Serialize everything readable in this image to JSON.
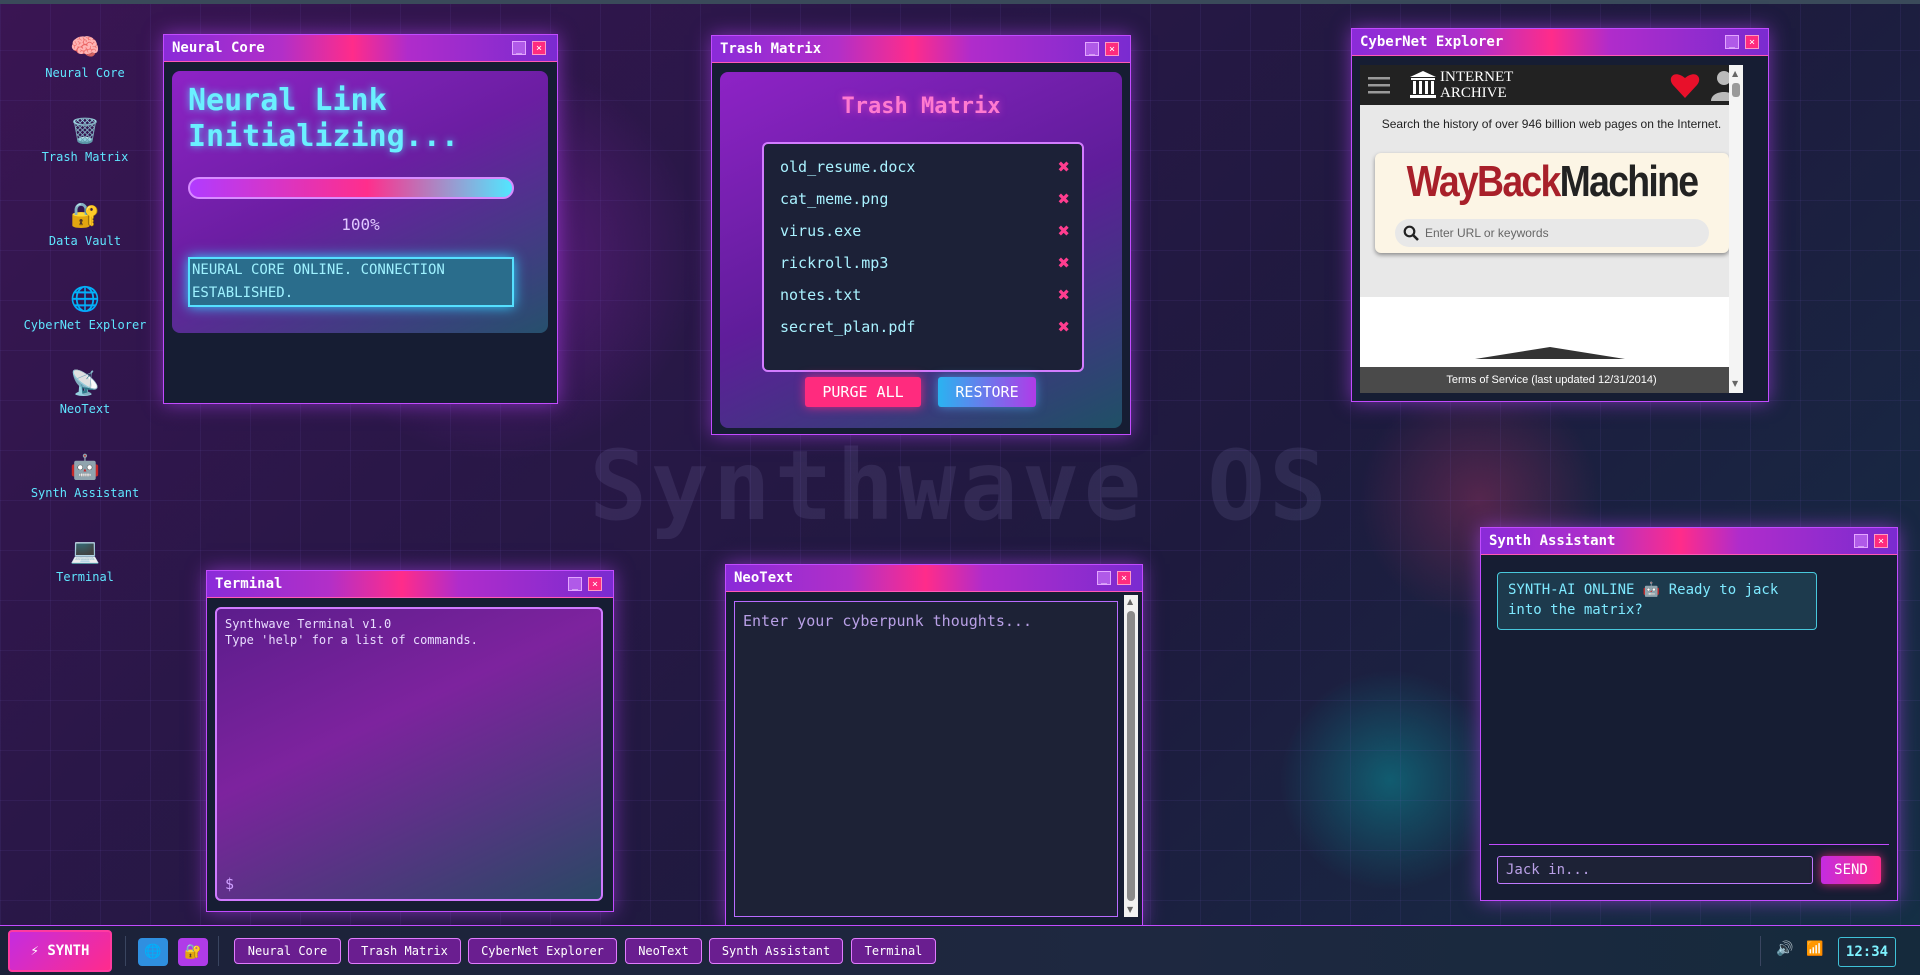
{
  "desktop": {
    "watermark": "Synthwave OS",
    "icons": [
      {
        "label": "Neural Core",
        "glyph": "🧠",
        "icon": "brain-icon"
      },
      {
        "label": "Trash Matrix",
        "glyph": "🗑️",
        "icon": "trash-icon"
      },
      {
        "label": "Data Vault",
        "glyph": "🔐",
        "icon": "lock-key-icon"
      },
      {
        "label": "CyberNet Explorer",
        "glyph": "🌐",
        "icon": "globe-icon"
      },
      {
        "label": "NeoText",
        "glyph": "📡",
        "icon": "satellite-dish-icon"
      },
      {
        "label": "Synth Assistant",
        "glyph": "🤖",
        "icon": "robot-icon"
      },
      {
        "label": "Terminal",
        "glyph": "💻",
        "icon": "laptop-icon"
      }
    ]
  },
  "window_controls": {
    "minimize": "_",
    "close": "×"
  },
  "neural_core": {
    "title": "Neural Core",
    "heading_line1": "Neural Link",
    "heading_line2": "Initializing...",
    "progress_value": 1.0,
    "progress_text": "100%",
    "status_message": "NEURAL CORE ONLINE. CONNECTION ESTABLISHED."
  },
  "trash_matrix": {
    "title": "Trash Matrix",
    "heading": "Trash Matrix",
    "files": [
      "old_resume.docx",
      "cat_meme.png",
      "virus.exe",
      "rickroll.mp3",
      "notes.txt",
      "secret_plan.pdf"
    ],
    "delete_glyph": "✖",
    "purge_label": "PURGE ALL",
    "restore_label": "RESTORE"
  },
  "cybernet_explorer": {
    "title": "CyberNet Explorer",
    "brand_line1": "INTERNET",
    "brand_line2": "ARCHIVE",
    "tagline": "Search the history of over 946 billion web pages on the Internet.",
    "logo_part1": "WayBack",
    "logo_part2": "Machine",
    "search_placeholder": "Enter URL or keywords",
    "footer": "Terms of Service (last updated 12/31/2014)"
  },
  "terminal": {
    "title": "Terminal",
    "line1": "Synthwave Terminal v1.0",
    "line2": "Type 'help' for a list of commands.",
    "prompt": "$"
  },
  "neotext": {
    "title": "NeoText",
    "placeholder": "Enter your cyberpunk thoughts..."
  },
  "synth_assistant": {
    "title": "Synth Assistant",
    "message": "SYNTH-AI ONLINE 🤖 Ready to jack into the matrix?",
    "input_placeholder": "Jack in...",
    "send_label": "SEND"
  },
  "taskbar": {
    "start_label": "⚡ SYNTH",
    "quick_launch": [
      {
        "glyph": "🌐",
        "icon": "globe-icon"
      },
      {
        "glyph": "🔐",
        "icon": "lock-key-icon"
      }
    ],
    "tasks": [
      "Neural Core",
      "Trash Matrix",
      "CyberNet Explorer",
      "NeoText",
      "Synth Assistant",
      "Terminal"
    ],
    "tray_volume": "🔊",
    "tray_signal": "📶",
    "clock": "12:34"
  },
  "colors": {
    "accent_pink": "#ff2b7e",
    "accent_cyan": "#5fe6ff",
    "accent_purple": "#c24bff",
    "background": "#2a1748"
  }
}
